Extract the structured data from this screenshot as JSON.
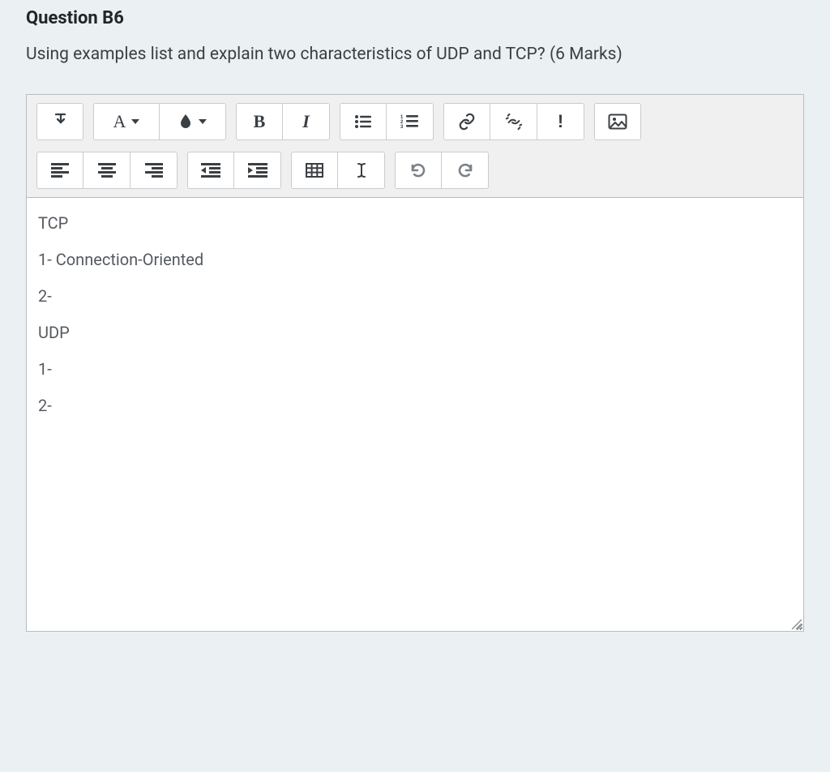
{
  "question": {
    "title": "Question B6",
    "text": "Using examples list and explain two characteristics of UDP and TCP? (6 Marks)"
  },
  "toolbar": {
    "font_letter": "A",
    "bold_label": "B",
    "italic_label": "I",
    "exclaim": "!"
  },
  "content": {
    "lines": [
      "TCP",
      "1- Connection-Oriented",
      "2-",
      "UDP",
      "1-",
      "2-"
    ]
  }
}
